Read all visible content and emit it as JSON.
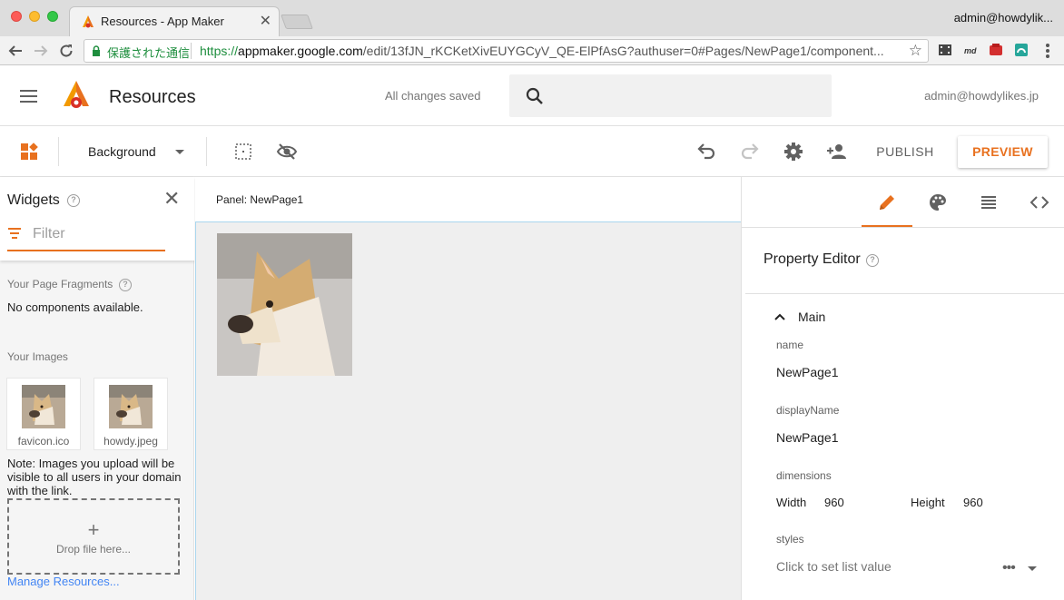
{
  "browser": {
    "tab_title": "Resources - App Maker",
    "tab_close": "✕",
    "user": "admin@howdylik...",
    "secure_label": "保護された通信",
    "url_scheme": "https://",
    "url_host": "appmaker.google.com",
    "url_path": "/edit/13fJN_rKCKetXivEUYGCyV_QE-ElPfAsG?authuser=0#Pages/NewPage1/component..."
  },
  "header": {
    "title": "Resources",
    "status": "All changes saved",
    "user": "admin@howdylikes.jp"
  },
  "toolbar": {
    "page_select": "Background",
    "publish_label": "PUBLISH",
    "preview_label": "PREVIEW"
  },
  "widgets": {
    "title": "Widgets",
    "help": "?",
    "close": "✕",
    "filter_placeholder": "Filter",
    "fragments_heading": "Your Page Fragments",
    "fragments_empty": "No components available.",
    "images_heading": "Your Images",
    "images": [
      {
        "caption": "favicon.ico"
      },
      {
        "caption": "howdy.jpeg"
      }
    ],
    "note": "Note: Images you upload will be visible to all users in your domain with the link.",
    "drop_plus": "+",
    "drop_label": "Drop file here...",
    "manage_link": "Manage Resources..."
  },
  "canvas": {
    "panel_label": "Panel: NewPage1"
  },
  "properties": {
    "title": "Property Editor",
    "section": "Main",
    "name_label": "name",
    "name_value": "NewPage1",
    "display_label": "displayName",
    "display_value": "NewPage1",
    "dimensions_label": "dimensions",
    "width_label": "Width",
    "width_value": "960",
    "height_label": "Height",
    "height_value": "960",
    "styles_label": "styles",
    "styles_hint": "Click to set list value",
    "more": "•••"
  },
  "colors": {
    "accent": "#e8711f",
    "link": "#4285f4",
    "secure": "#1e8e3e"
  }
}
